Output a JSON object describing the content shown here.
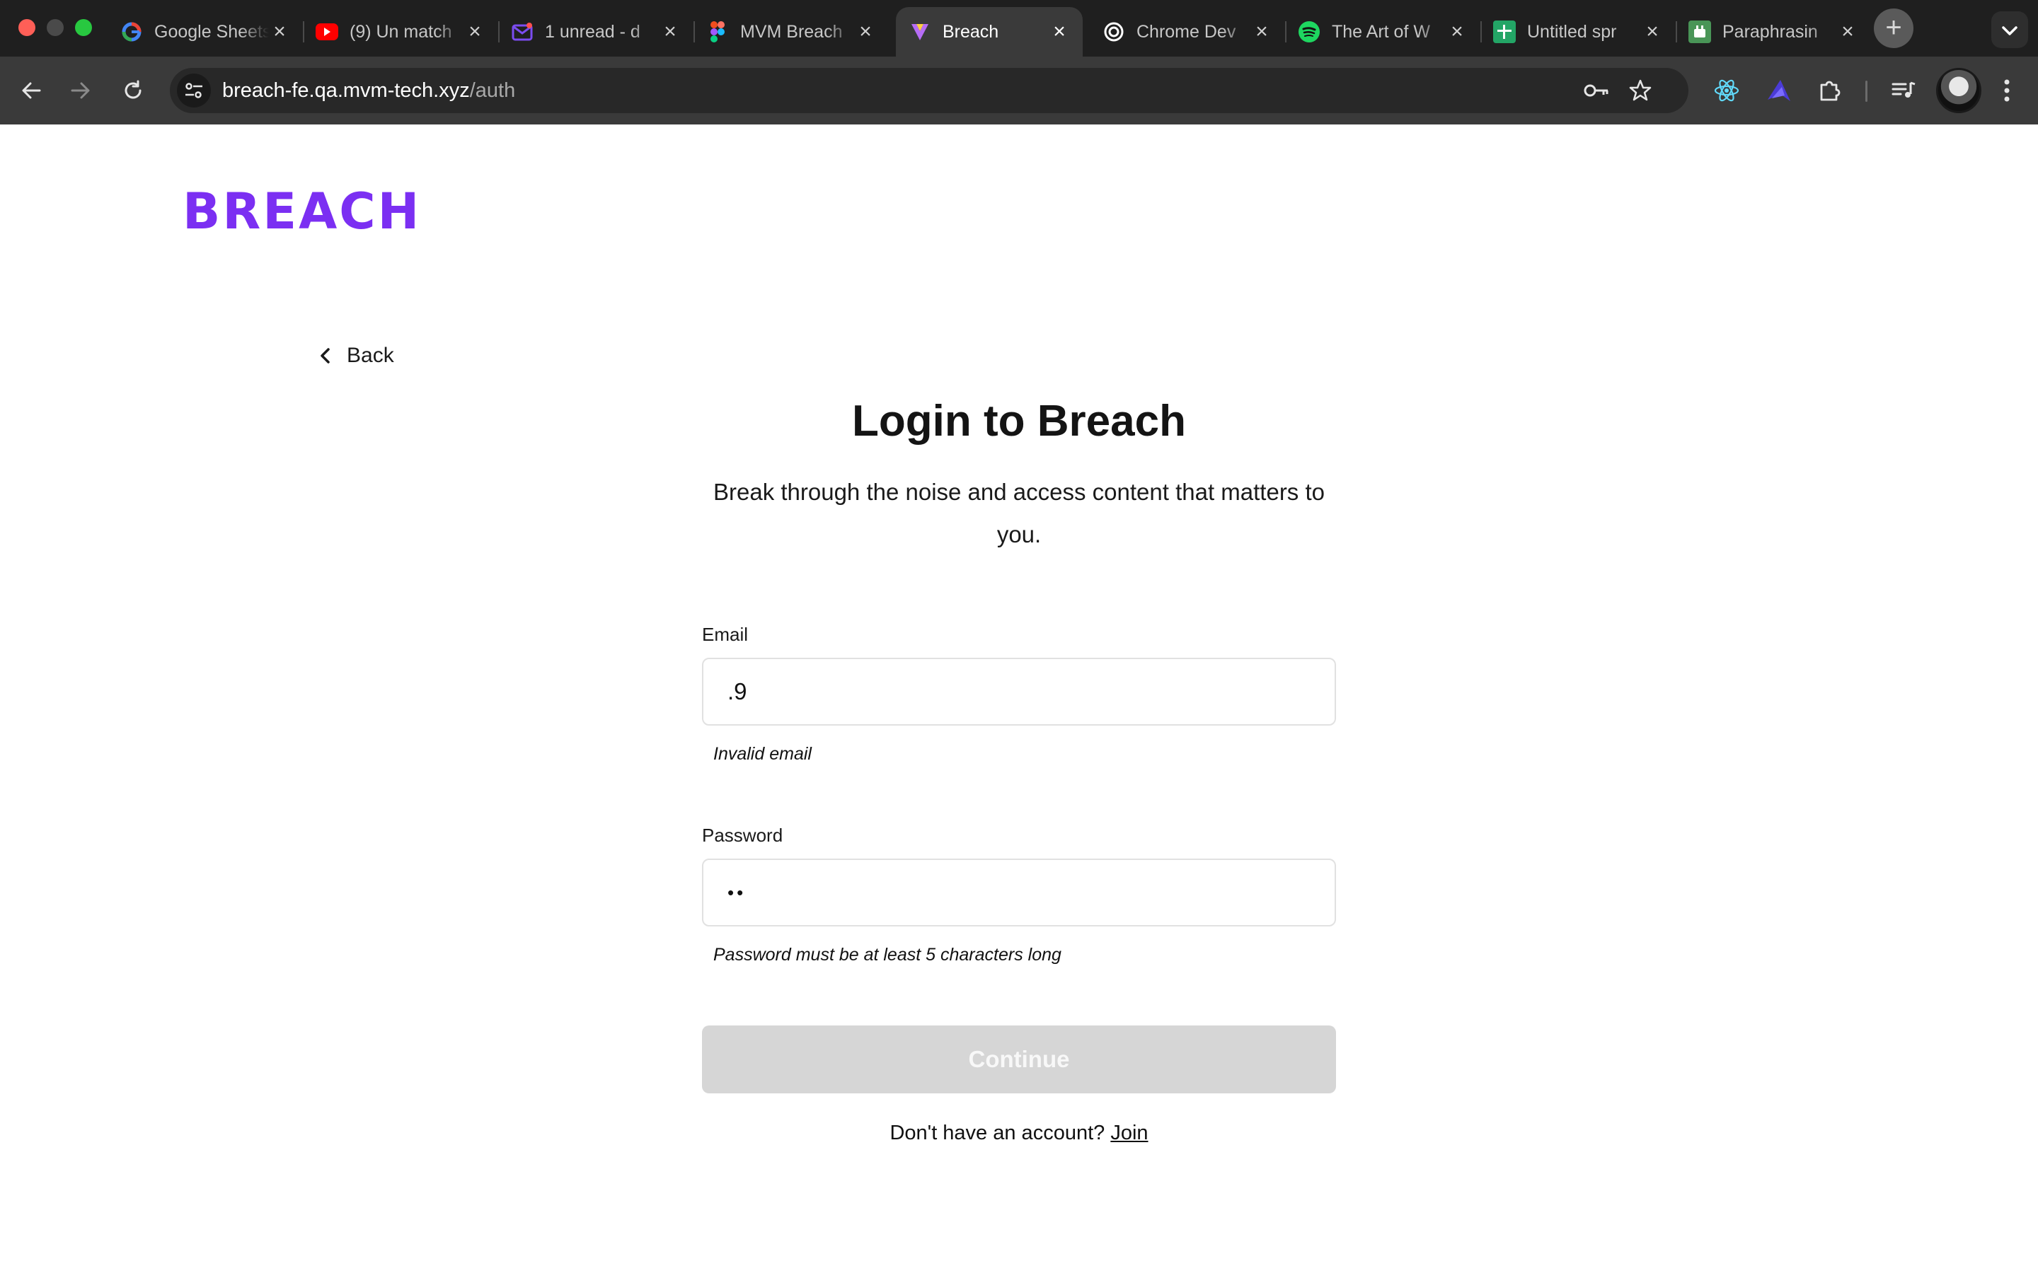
{
  "browser": {
    "tabs": [
      {
        "title": "Google Sheets",
        "favicon": "google-icon",
        "color": "#ffffff",
        "active": false
      },
      {
        "title": "(9) Un match",
        "favicon": "youtube-icon",
        "color": "#ff0000",
        "active": false
      },
      {
        "title": "1 unread - d",
        "favicon": "mail-icon",
        "color": "#7b4cf0",
        "active": false
      },
      {
        "title": "MVM Breach",
        "favicon": "figma-icon",
        "color": "#f24e1e",
        "active": false
      },
      {
        "title": "Breach",
        "favicon": "breach-icon",
        "color": "#b66cf6",
        "active": true
      },
      {
        "title": "Chrome Dev",
        "favicon": "openai-icon",
        "color": "#ffffff",
        "active": false
      },
      {
        "title": "The Art of W",
        "favicon": "spotify-icon",
        "color": "#1ed760",
        "active": false
      },
      {
        "title": "Untitled spr",
        "favicon": "sheets-icon",
        "color": "#23a566",
        "active": false
      },
      {
        "title": "Paraphrasin",
        "favicon": "quillbot-icon",
        "color": "#499557",
        "active": false
      }
    ],
    "url_host": "breach-fe.qa.mvm-tech.xyz",
    "url_path": "/auth"
  },
  "page": {
    "logo_text": "BREACH",
    "brand_color": "#7b2ff2",
    "back_label": "Back",
    "title": "Login to Breach",
    "subtitle": "Break through the noise and access content that matters to you.",
    "email": {
      "label": "Email",
      "value": ".9",
      "error": "Invalid email"
    },
    "password": {
      "label": "Password",
      "value_masked": "••",
      "error": "Password must be at least 5 characters long"
    },
    "continue_label": "Continue",
    "signup_prompt": "Don't have an account?",
    "signup_link": "Join"
  }
}
